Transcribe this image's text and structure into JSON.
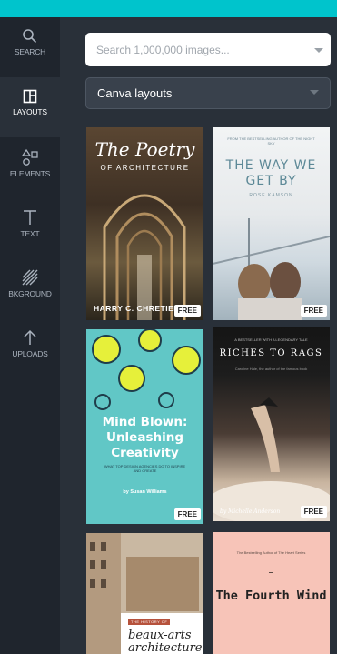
{
  "sidebar": {
    "items": [
      {
        "label": "SEARCH",
        "icon": "search-icon"
      },
      {
        "label": "LAYOUTS",
        "icon": "layouts-icon"
      },
      {
        "label": "ELEMENTS",
        "icon": "elements-icon"
      },
      {
        "label": "TEXT",
        "icon": "text-icon"
      },
      {
        "label": "BKGROUND",
        "icon": "background-icon"
      },
      {
        "label": "UPLOADS",
        "icon": "uploads-icon"
      }
    ]
  },
  "search": {
    "placeholder": "Search 1,000,000 images..."
  },
  "filter": {
    "selected": "Canva layouts"
  },
  "badge_label": "FREE",
  "layouts": [
    {
      "title": "The Poetry",
      "subtitle": "OF ARCHITECTURE",
      "author": "HARRY C. CHRETIEN"
    },
    {
      "top_line": "FROM THE BESTSELLING AUTHOR OF THE NIGHT SKY",
      "title": "THE WAY WE GET BY",
      "author": "ROSE KAMSON"
    },
    {
      "title": "Mind Blown: Unleashing Creativity",
      "tagline": "WHAT TOP DESIGN AGENCIES DO TO INSPIRE AND CREATE",
      "author": "by Susan Williams"
    },
    {
      "top_line": "A BESTSELLER WITH A LEGENDARY TALE",
      "title": "RICHES TO RAGS",
      "blurb": "Caroline Hale, the author of the famous book",
      "author": "by Michelle Anderson"
    },
    {
      "top_line": "THE HISTORY OF",
      "title": "beaux-arts architecture"
    },
    {
      "top_line": "The Bestselling Author of The Heart Series",
      "title": "The Fourth Wind"
    }
  ],
  "colors": {
    "accent": "#00c4cc",
    "rail": "#1f252d",
    "panel": "#293039"
  }
}
